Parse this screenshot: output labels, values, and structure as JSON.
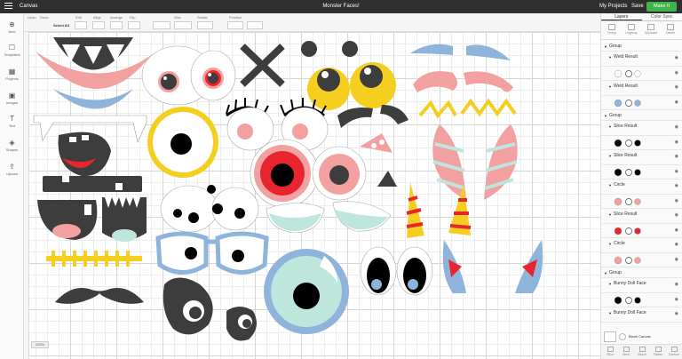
{
  "topbar": {
    "app_title": "Canvas",
    "project_title": "Monster Faces!",
    "my_projects": "My Projects",
    "save": "Save",
    "make_it": "Make It"
  },
  "toolbar": {
    "items": [
      "Undo",
      "Redo",
      "Select All",
      "Edit",
      "Align",
      "Arrange",
      "Flip",
      "Size",
      "Rotate",
      "Position"
    ],
    "linetype_label": "Linetype",
    "fill_label": "Fill"
  },
  "leftbar": {
    "items": [
      "New",
      "Templates",
      "Projects",
      "Images",
      "Text",
      "Shapes",
      "Upload"
    ]
  },
  "right_panel": {
    "tabs": [
      "Layers",
      "Color Sync"
    ],
    "actions": [
      "Group",
      "Ungroup",
      "Duplicate",
      "Delete"
    ],
    "layers": [
      {
        "type": "header",
        "name": "Group"
      },
      {
        "type": "sub",
        "name": "Weld Result"
      },
      {
        "type": "row"
      },
      {
        "type": "sub",
        "name": "Weld Result"
      },
      {
        "type": "row"
      },
      {
        "type": "header",
        "name": "Group"
      },
      {
        "type": "sub",
        "name": "Slice Result"
      },
      {
        "type": "row"
      },
      {
        "type": "sub",
        "name": "Slice Result"
      },
      {
        "type": "row"
      },
      {
        "type": "sub",
        "name": "Circle"
      },
      {
        "type": "row"
      },
      {
        "type": "sub",
        "name": "Slice Result"
      },
      {
        "type": "row"
      },
      {
        "type": "sub",
        "name": "Circle"
      },
      {
        "type": "row"
      },
      {
        "type": "header",
        "name": "Group"
      },
      {
        "type": "sub",
        "name": "Bunny Doll Face"
      },
      {
        "type": "row"
      },
      {
        "type": "sub",
        "name": "Bunny Doll Face"
      }
    ],
    "blank_canvas": "Blank Canvas",
    "bottom_actions": [
      "Slice",
      "Weld",
      "Attach",
      "Flatten",
      "Contour"
    ]
  },
  "canvas": {
    "zoom": "100%"
  },
  "colors": {
    "topbar": "#2f2f2f",
    "make_it": "#3db54a",
    "pink": "#f2a0a0",
    "blue": "#8fb4dc",
    "yellow": "#f5cf1f",
    "red": "#e8242f",
    "dark": "#3d3d3d",
    "mint": "#bfe6dc"
  }
}
